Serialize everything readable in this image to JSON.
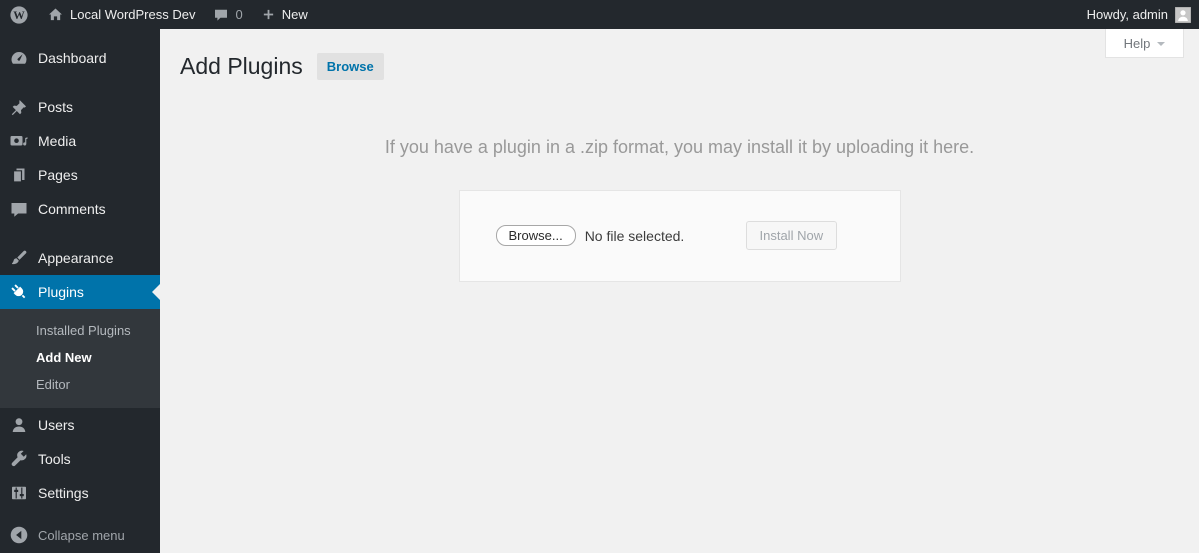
{
  "admin_bar": {
    "site_name": "Local WordPress Dev",
    "comments_count": "0",
    "new_label": "New",
    "howdy": "Howdy, admin",
    "icons": [
      "wordpress-logo-icon",
      "home-icon",
      "comments-bubble-icon",
      "plus-icon",
      "avatar"
    ]
  },
  "sidebar": {
    "items": [
      {
        "label": "Dashboard",
        "icon": "dashboard-icon"
      },
      {
        "label": "Posts",
        "icon": "pushpin-icon"
      },
      {
        "label": "Media",
        "icon": "media-icon"
      },
      {
        "label": "Pages",
        "icon": "pages-icon"
      },
      {
        "label": "Comments",
        "icon": "comment-icon"
      },
      {
        "label": "Appearance",
        "icon": "brush-icon"
      },
      {
        "label": "Plugins",
        "icon": "plug-icon",
        "active": true
      },
      {
        "label": "Users",
        "icon": "user-icon"
      },
      {
        "label": "Tools",
        "icon": "wrench-icon"
      },
      {
        "label": "Settings",
        "icon": "settings-icon"
      }
    ],
    "plugins_submenu": [
      {
        "label": "Installed Plugins"
      },
      {
        "label": "Add New",
        "current": true
      },
      {
        "label": "Editor"
      }
    ],
    "collapse_label": "Collapse menu"
  },
  "content": {
    "help_label": "Help",
    "page_title": "Add Plugins",
    "browse_button": "Browse",
    "upload_help": "If you have a plugin in a .zip format, you may install it by uploading it here.",
    "file_input": {
      "button": "Browse...",
      "status": "No file selected."
    },
    "install_button": "Install Now"
  },
  "colors": {
    "accent_blue": "#0073aa",
    "admin_bar_bg": "#23282d",
    "submenu_bg": "#32373c",
    "content_bg": "#f1f1f1",
    "icon_gray": "#a0a5aa"
  }
}
